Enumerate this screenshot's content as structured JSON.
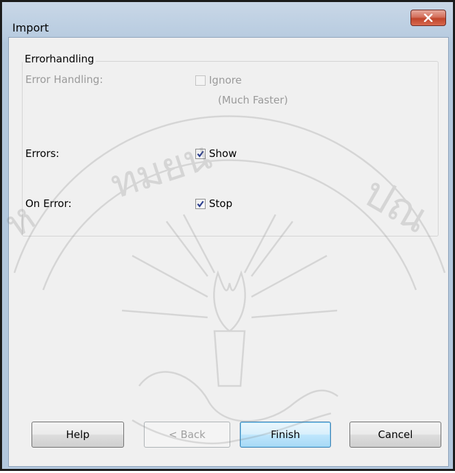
{
  "window": {
    "title": "Import"
  },
  "errorhandling": {
    "group_title": "Errorhandling",
    "error_handling_label": "Error Handling:",
    "ignore_label": "Ignore",
    "ignore_hint": "(Much Faster)",
    "ignore_checked": false,
    "errors_label": "Errors:",
    "show_label": "Show",
    "show_checked": true,
    "on_error_label": "On Error:",
    "stop_label": "Stop",
    "stop_checked": true
  },
  "buttons": {
    "help": "Help",
    "back": "< Back",
    "finish": "Finish",
    "cancel": "Cancel"
  },
  "icons": {
    "close": "close-icon",
    "check": "checkmark-icon"
  },
  "colors": {
    "title_bar": "#b8cce0",
    "client_bg": "#f0f0f0",
    "close_button": "#c0442b",
    "disabled_text": "#9a9a9a"
  }
}
